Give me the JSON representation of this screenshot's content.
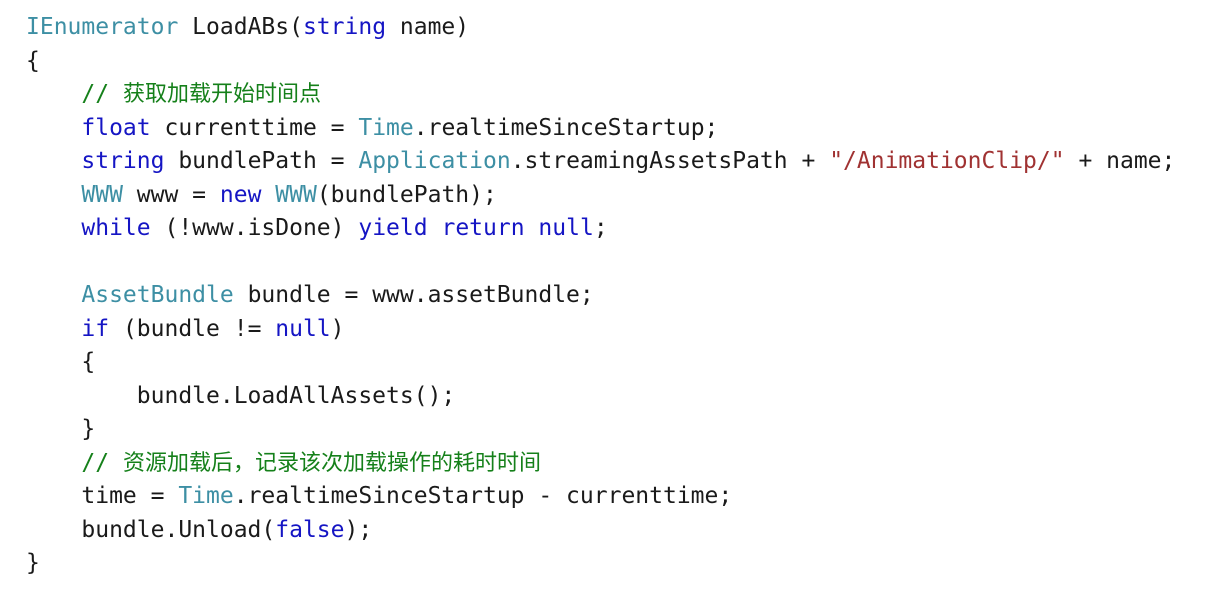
{
  "editor": {
    "language": "csharp",
    "background_color": "#ffffff",
    "font_size_px": 23,
    "line_height_px": 33.5,
    "colors": {
      "plain": "#1a1a1a",
      "keyword": "#1515c4",
      "type": "#3d8fa4",
      "string": "#a03232",
      "comment": "#15801a"
    },
    "lines": [
      {
        "index": 0,
        "text": "IEnumerator LoadABs(string name)",
        "tokens": [
          {
            "t": "IEnumerator",
            "k": "type"
          },
          {
            "t": " LoadABs(",
            "k": "plain"
          },
          {
            "t": "string",
            "k": "keyword"
          },
          {
            "t": " name)",
            "k": "plain"
          }
        ]
      },
      {
        "index": 1,
        "text": "{",
        "tokens": [
          {
            "t": "{",
            "k": "plain"
          }
        ]
      },
      {
        "index": 2,
        "text": "    // 获取加载开始时间点",
        "tokens": [
          {
            "t": "    ",
            "k": "plain"
          },
          {
            "t": "// ",
            "k": "comment"
          },
          {
            "t": "获取加载开始时间点",
            "k": "comment",
            "cjk": true
          }
        ]
      },
      {
        "index": 3,
        "text": "    float currenttime = Time.realtimeSinceStartup;",
        "tokens": [
          {
            "t": "    ",
            "k": "plain"
          },
          {
            "t": "float",
            "k": "keyword"
          },
          {
            "t": " currenttime = ",
            "k": "plain"
          },
          {
            "t": "Time",
            "k": "type"
          },
          {
            "t": ".realtimeSinceStartup;",
            "k": "plain"
          }
        ]
      },
      {
        "index": 4,
        "text": "    string bundlePath = Application.streamingAssetsPath + \"/AnimationClip/\" + name;",
        "tokens": [
          {
            "t": "    ",
            "k": "plain"
          },
          {
            "t": "string",
            "k": "keyword"
          },
          {
            "t": " bundlePath = ",
            "k": "plain"
          },
          {
            "t": "Application",
            "k": "type"
          },
          {
            "t": ".streamingAssetsPath + ",
            "k": "plain"
          },
          {
            "t": "\"/AnimationClip/\"",
            "k": "string"
          },
          {
            "t": " + name;",
            "k": "plain"
          }
        ]
      },
      {
        "index": 5,
        "text": "    WWW www = new WWW(bundlePath);",
        "tokens": [
          {
            "t": "    ",
            "k": "plain"
          },
          {
            "t": "WWW",
            "k": "type"
          },
          {
            "t": " www = ",
            "k": "plain"
          },
          {
            "t": "new",
            "k": "keyword"
          },
          {
            "t": " ",
            "k": "plain"
          },
          {
            "t": "WWW",
            "k": "type"
          },
          {
            "t": "(bundlePath);",
            "k": "plain"
          }
        ]
      },
      {
        "index": 6,
        "text": "    while (!www.isDone) yield return null;",
        "tokens": [
          {
            "t": "    ",
            "k": "plain"
          },
          {
            "t": "while",
            "k": "keyword"
          },
          {
            "t": " (!www.isDone) ",
            "k": "plain"
          },
          {
            "t": "yield",
            "k": "keyword"
          },
          {
            "t": " ",
            "k": "plain"
          },
          {
            "t": "return",
            "k": "keyword"
          },
          {
            "t": " ",
            "k": "plain"
          },
          {
            "t": "null",
            "k": "keyword"
          },
          {
            "t": ";",
            "k": "plain"
          }
        ]
      },
      {
        "index": 7,
        "text": "",
        "tokens": []
      },
      {
        "index": 8,
        "text": "    AssetBundle bundle = www.assetBundle;",
        "tokens": [
          {
            "t": "    ",
            "k": "plain"
          },
          {
            "t": "AssetBundle",
            "k": "type"
          },
          {
            "t": " bundle = www.assetBundle;",
            "k": "plain"
          }
        ]
      },
      {
        "index": 9,
        "text": "    if (bundle != null)",
        "tokens": [
          {
            "t": "    ",
            "k": "plain"
          },
          {
            "t": "if",
            "k": "keyword"
          },
          {
            "t": " (bundle != ",
            "k": "plain"
          },
          {
            "t": "null",
            "k": "keyword"
          },
          {
            "t": ")",
            "k": "plain"
          }
        ]
      },
      {
        "index": 10,
        "text": "    {",
        "tokens": [
          {
            "t": "    {",
            "k": "plain"
          }
        ]
      },
      {
        "index": 11,
        "text": "        bundle.LoadAllAssets();",
        "tokens": [
          {
            "t": "        bundle.LoadAllAssets();",
            "k": "plain"
          }
        ]
      },
      {
        "index": 12,
        "text": "    }",
        "tokens": [
          {
            "t": "    }",
            "k": "plain"
          }
        ]
      },
      {
        "index": 13,
        "text": "    // 资源加载后，记录该次加载操作的耗时时间",
        "tokens": [
          {
            "t": "    ",
            "k": "plain"
          },
          {
            "t": "// ",
            "k": "comment"
          },
          {
            "t": "资源加载后，记录该次加载操作的耗时时间",
            "k": "comment",
            "cjk": true
          }
        ]
      },
      {
        "index": 14,
        "text": "    time = Time.realtimeSinceStartup - currenttime;",
        "tokens": [
          {
            "t": "    time = ",
            "k": "plain"
          },
          {
            "t": "Time",
            "k": "type"
          },
          {
            "t": ".realtimeSinceStartup - currenttime;",
            "k": "plain"
          }
        ]
      },
      {
        "index": 15,
        "text": "    bundle.Unload(false);",
        "tokens": [
          {
            "t": "    bundle.Unload(",
            "k": "plain"
          },
          {
            "t": "false",
            "k": "keyword"
          },
          {
            "t": ");",
            "k": "plain"
          }
        ]
      },
      {
        "index": 16,
        "text": "}",
        "tokens": [
          {
            "t": "}",
            "k": "plain"
          }
        ]
      }
    ]
  }
}
